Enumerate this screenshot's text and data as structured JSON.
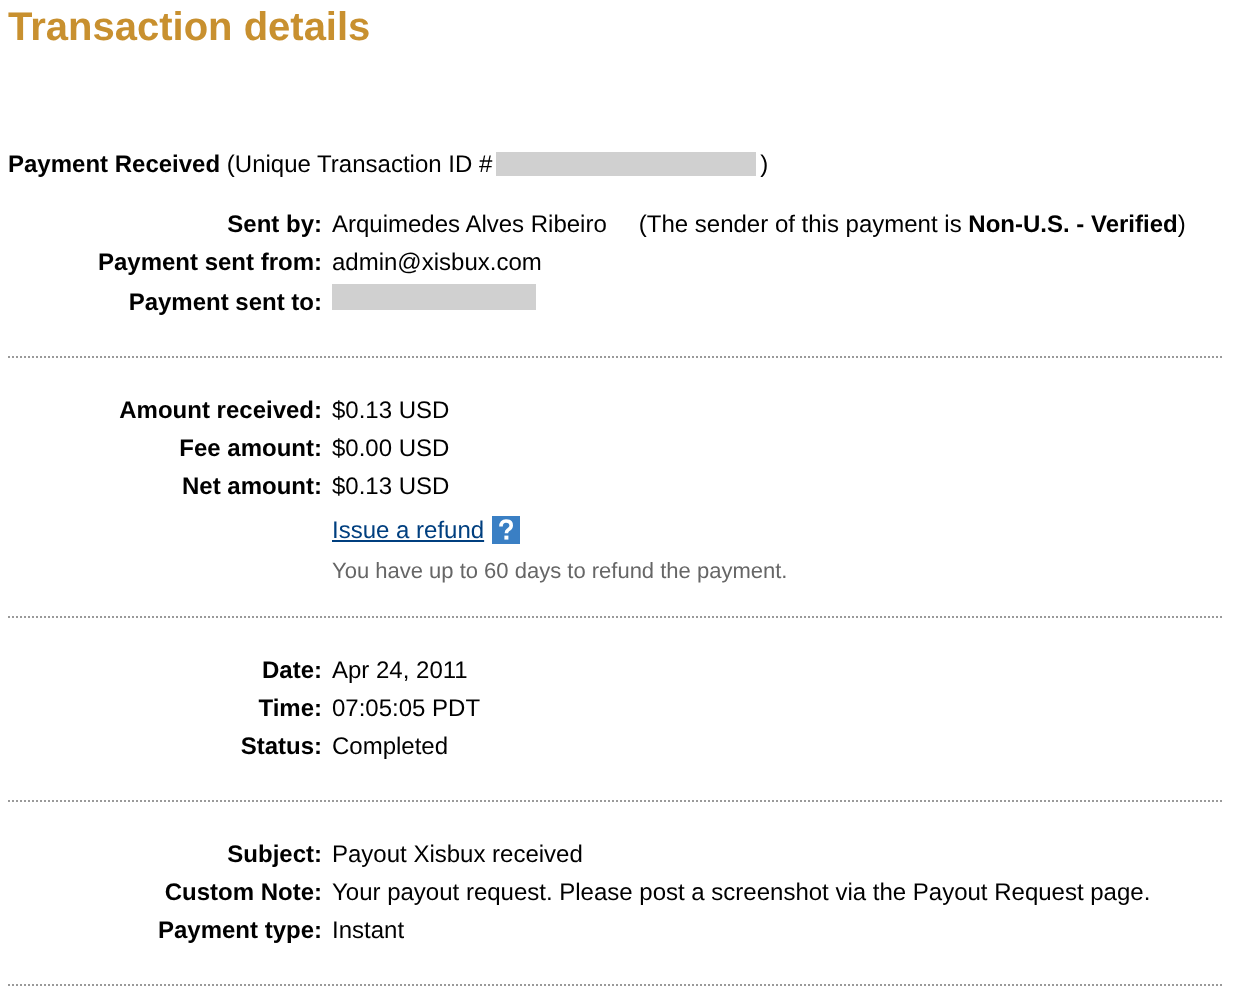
{
  "title": "Transaction details",
  "header": {
    "label": "Payment Received",
    "prefix": "(Unique Transaction ID #",
    "suffix": ")"
  },
  "sections": [
    {
      "rows": [
        {
          "kind": "text",
          "label": "Sent by:",
          "value": "Arquimedes Alves Ribeiro",
          "note": "(The sender of this payment is **Non-U.S. - Verified**)"
        },
        {
          "kind": "text",
          "label": "Payment sent from:",
          "value": "admin@xisbux.com"
        },
        {
          "kind": "redacted",
          "label": "Payment sent to:"
        }
      ]
    },
    {
      "rows": [
        {
          "kind": "text",
          "label": "Amount received:",
          "value": "$0.13 USD"
        },
        {
          "kind": "text",
          "label": "Fee amount:",
          "value": "$0.00 USD"
        },
        {
          "kind": "text",
          "label": "Net amount:",
          "value": "$0.13 USD"
        }
      ],
      "refund": {
        "link": "Issue a refund",
        "hint": "You have up to 60 days to refund the payment."
      }
    },
    {
      "rows": [
        {
          "kind": "text",
          "label": "Date:",
          "value": "Apr 24, 2011"
        },
        {
          "kind": "text",
          "label": "Time:",
          "value": "07:05:05 PDT"
        },
        {
          "kind": "text",
          "label": "Status:",
          "value": "Completed"
        }
      ]
    },
    {
      "rows": [
        {
          "kind": "text",
          "label": "Subject:",
          "value": "Payout Xisbux received"
        },
        {
          "kind": "text",
          "label": "Custom Note:",
          "value": "Your payout request. Please post a screenshot via the Payout Request page."
        },
        {
          "kind": "text",
          "label": "Payment type:",
          "value": "Instant"
        }
      ]
    }
  ]
}
